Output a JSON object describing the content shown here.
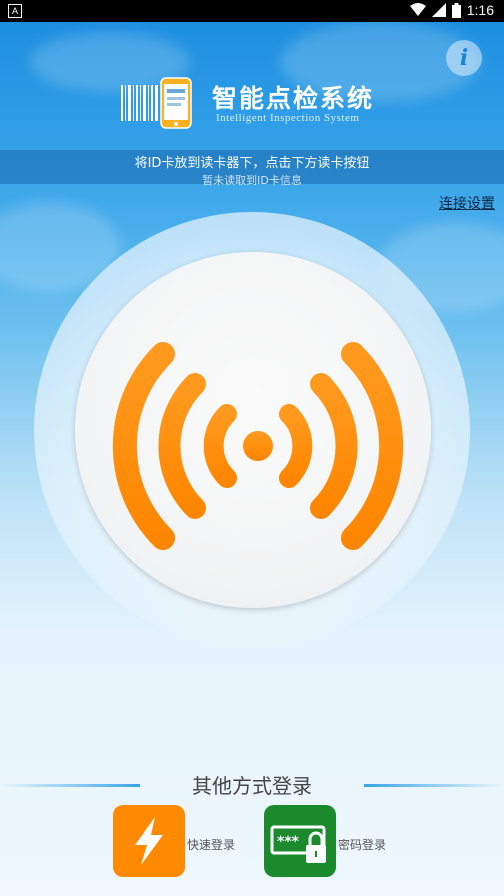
{
  "status_bar": {
    "time": "1:16",
    "notification_icon": "A"
  },
  "header": {
    "app_title": "智能点检系统",
    "app_subtitle": "Intelligent Inspection System",
    "info_label": "i"
  },
  "banner": {
    "instruction": "将ID卡放到读卡器下，点击下方读卡按钮",
    "status": "暂未读取到ID卡信息"
  },
  "connection_settings_label": "连接设置",
  "other_login": {
    "title": "其他方式登录",
    "quick_login_label": "快速登录",
    "password_login_label": "密码登录",
    "password_mask": "***"
  },
  "colors": {
    "primary_blue": "#1d8fe0",
    "signal_orange": "#ff8a00",
    "quick_tile": "#ff8a00",
    "password_tile": "#1a8a2c"
  }
}
